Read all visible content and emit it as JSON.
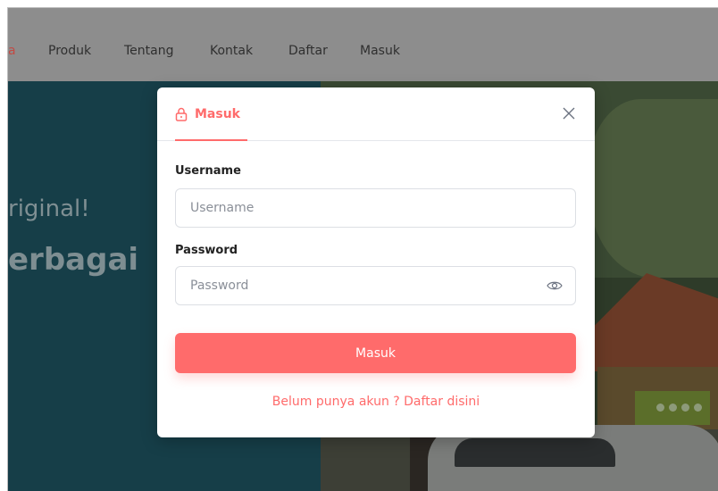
{
  "navbar": {
    "items": [
      {
        "label": "a",
        "active": true
      },
      {
        "label": "Produk"
      },
      {
        "label": "Tentang"
      },
      {
        "label": "Kontak"
      },
      {
        "label": "Daftar"
      },
      {
        "label": "Masuk"
      }
    ]
  },
  "hero": {
    "line1": "riginal!",
    "line2": "erbagai"
  },
  "modal": {
    "title": "Masuk",
    "title_icon": "lock-icon",
    "close_icon": "close-icon",
    "username": {
      "label": "Username",
      "placeholder": "Username",
      "value": ""
    },
    "password": {
      "label": "Password",
      "placeholder": "Password",
      "value": "",
      "toggle_icon": "eye-icon"
    },
    "submit_label": "Masuk",
    "register_link": "Belum punya akun ? Daftar disini"
  },
  "colors": {
    "accent": "#ff6b6b",
    "overlay": "#8d8d8d"
  }
}
